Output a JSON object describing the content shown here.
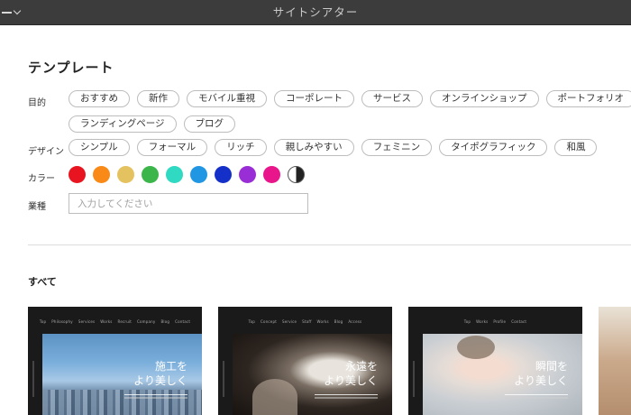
{
  "titlebar": {
    "title": "サイトシアター",
    "menu_icon": "hamburger-chevron-icon"
  },
  "template": {
    "heading": "テンプレート",
    "purpose": {
      "label": "目的",
      "chips": [
        "おすすめ",
        "新作",
        "モバイル重視",
        "コーポレート",
        "サービス",
        "オンラインショップ",
        "ポートフォリオ",
        "ランディングページ",
        "ブログ"
      ]
    },
    "design": {
      "label": "デザイン",
      "chips": [
        "シンプル",
        "フォーマル",
        "リッチ",
        "親しみやすい",
        "フェミニン",
        "タイポグラフィック",
        "和風"
      ]
    },
    "color": {
      "label": "カラー",
      "swatches": [
        "#e8141f",
        "#f98a17",
        "#e5c260",
        "#3cb64a",
        "#2fd9c2",
        "#2196e3",
        "#1530c9",
        "#9a2ed6",
        "#e8158b",
        "monochrome"
      ]
    },
    "industry": {
      "label": "業種",
      "placeholder": "入力してください",
      "value": ""
    }
  },
  "gallery": {
    "heading": "すべて",
    "cards": [
      {
        "caption_line1": "施工を",
        "caption_line2": "より美しく"
      },
      {
        "caption_line1": "永遠を",
        "caption_line2": "より美しく"
      },
      {
        "caption_line1": "瞬間を",
        "caption_line2": "より美しく"
      },
      {
        "caption_line1": "",
        "caption_line2": ""
      }
    ]
  },
  "colors": {
    "titlebar_bg": "#3c3c3c",
    "chip_border": "#bdbdbd",
    "card_bg": "#1a1a1a"
  }
}
